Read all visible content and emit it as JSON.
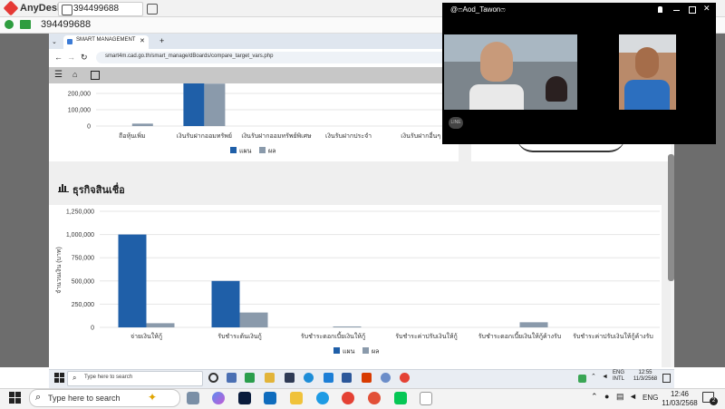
{
  "anydesk": {
    "app_name": "AnyDesk",
    "tab_id": "394499688",
    "session_id": "394499688"
  },
  "browser": {
    "tab_title": "SMART MANAGEMENT",
    "new_tab": "+",
    "url": "smart4m.cad.go.th/smart_manage/dBoards/compare_target_vars.php"
  },
  "top_chart": {
    "y_ticks": [
      "200,000",
      "100,000",
      "0"
    ],
    "categories": [
      "ถือหุ้นเพิ่ม",
      "เงินรับฝากออมทรัพย์",
      "เงินรับฝากออมทรัพย์พิเศษ",
      "เงินรับฝากประจำ",
      "เงินรับฝากอื่นๆ"
    ]
  },
  "section": {
    "title": "ธุรกิจสินเชื่อ"
  },
  "legend": {
    "plan": "แผน",
    "actual": "ผล"
  },
  "chart_data": [
    {
      "type": "bar",
      "title": "",
      "ylabel": "",
      "categories": [
        "ถือหุ้นเพิ่ม",
        "เงินรับฝากออมทรัพย์",
        "เงินรับฝากออมทรัพย์พิเศษ",
        "เงินรับฝากประจำ",
        "เงินรับฝากอื่นๆ"
      ],
      "series": [
        {
          "name": "แผน",
          "values": [
            0,
            270000,
            0,
            0,
            0
          ]
        },
        {
          "name": "ผล",
          "values": [
            15000,
            260000,
            0,
            0,
            0
          ]
        }
      ],
      "ylim": [
        0,
        260000
      ]
    },
    {
      "type": "bar",
      "title": "ธุรกิจสินเชื่อ",
      "ylabel": "จำนวนเงิน (บาท)",
      "categories": [
        "จ่ายเงินให้กู้",
        "รับชำระต้นเงินกู้",
        "รับชำระดอกเบี้ยเงินให้กู้",
        "รับชำระค่าปรับเงินให้กู้",
        "รับชำระดอกเบี้ยเงินให้กู้ค้างรับ",
        "รับชำระค่าปรับเงินให้กู้ค้างรับ"
      ],
      "y_ticks": [
        "1,250,000",
        "1,000,000",
        "750,000",
        "500,000",
        "250,000",
        "0"
      ],
      "series": [
        {
          "name": "แผน",
          "values": [
            1000000,
            500000,
            0,
            0,
            0,
            0
          ]
        },
        {
          "name": "ผล",
          "values": [
            45000,
            160000,
            10000,
            0,
            55000,
            0
          ]
        }
      ],
      "ylim": [
        0,
        1250000
      ],
      "legend_position": "bottom",
      "colors": {
        "plan": "#1f5fa8",
        "actual": "#8a9aab"
      }
    }
  ],
  "video_call": {
    "title": "@ෆAod_Tawonෆ",
    "app_badge": "LINE"
  },
  "remote_taskbar": {
    "search_placeholder": "Type here to search",
    "lang": "ENG",
    "lang_sub": "INTL",
    "time": "12:55",
    "date": "11/3/2568"
  },
  "taskbar": {
    "search_placeholder": "Type here to search",
    "lang": "ENG",
    "time": "12:46",
    "date": "11/03/2568",
    "notif_count": "2"
  },
  "colors": {
    "plan": "#1f5fa8",
    "actual": "#8a9aab",
    "anydesk_red": "#e53935"
  }
}
